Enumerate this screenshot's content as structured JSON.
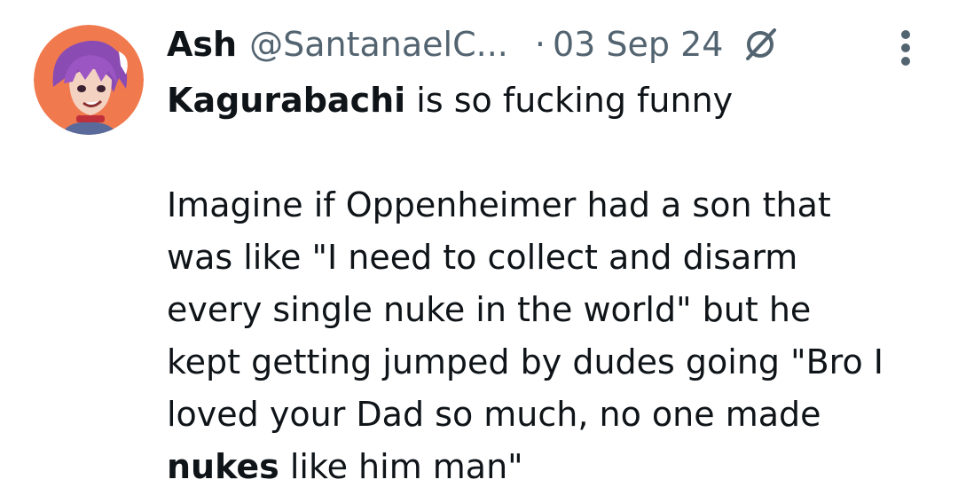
{
  "tweet": {
    "author": {
      "name": "Ash",
      "handle": "@SantanaelC...",
      "avatar_icon": "avatar-anime-character"
    },
    "separator": "·",
    "date": "03 Sep 24",
    "icons": {
      "grok": "grok-icon",
      "more": "more-options-icon"
    },
    "line1_bold": "Kagurabachi",
    "line1_rest": " is so fucking funny",
    "para2_lines": [
      "Imagine if Oppenheimer had a son that",
      "was like \"I need to collect and disarm",
      "every single nuke in the world\" but he",
      "kept getting jumped by dudes going \"Bro I",
      "loved your Dad so much, no one made"
    ],
    "last_bold": "nukes",
    "last_rest": " like him man\""
  }
}
